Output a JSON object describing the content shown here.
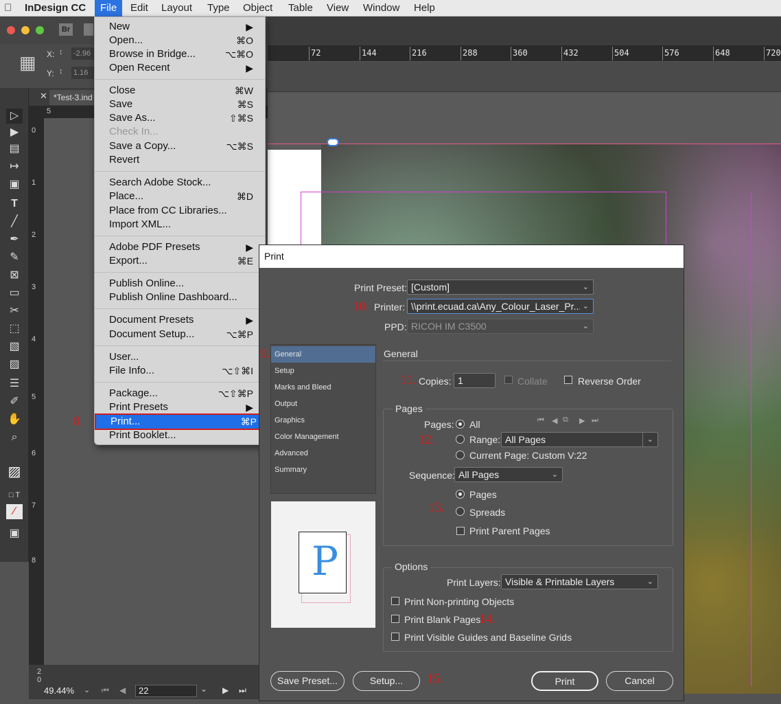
{
  "menubar": {
    "app": "InDesign CC",
    "items": [
      "File",
      "Edit",
      "Layout",
      "Type",
      "Object",
      "Table",
      "View",
      "Window",
      "Help"
    ]
  },
  "control": {
    "x_label": "X:",
    "y_label": "Y:",
    "x_value": "-2.96",
    "y_value": "1.16"
  },
  "ruler": {
    "ticks": [
      "72",
      "144",
      "216",
      "288",
      "360",
      "432",
      "504",
      "576",
      "648",
      "720"
    ],
    "left_tick": "5",
    "vticks": [
      "0",
      "1",
      "2",
      "3",
      "4",
      "5",
      "6",
      "7",
      "8"
    ]
  },
  "doc_tab": "*Test-3.ind",
  "statusbar": {
    "zoom": "49.44%",
    "page": "22",
    "left_num": "2 0"
  },
  "file_menu": {
    "items": [
      {
        "label": "New",
        "shortcut": "▶"
      },
      {
        "label": "Open...",
        "shortcut": "⌘O"
      },
      {
        "label": "Browse in Bridge...",
        "shortcut": "⌥⌘O"
      },
      {
        "label": "Open Recent",
        "shortcut": "▶"
      },
      {
        "label": "Close",
        "shortcut": "⌘W"
      },
      {
        "label": "Save",
        "shortcut": "⌘S"
      },
      {
        "label": "Save As...",
        "shortcut": "⇧⌘S"
      },
      {
        "label": "Check In...",
        "shortcut": ""
      },
      {
        "label": "Save a Copy...",
        "shortcut": "⌥⌘S"
      },
      {
        "label": "Revert",
        "shortcut": ""
      },
      {
        "label": "Search Adobe Stock...",
        "shortcut": ""
      },
      {
        "label": "Place...",
        "shortcut": "⌘D"
      },
      {
        "label": "Place from CC Libraries...",
        "shortcut": ""
      },
      {
        "label": "Import XML...",
        "shortcut": ""
      },
      {
        "label": "Adobe PDF Presets",
        "shortcut": "▶"
      },
      {
        "label": "Export...",
        "shortcut": "⌘E"
      },
      {
        "label": "Publish Online...",
        "shortcut": ""
      },
      {
        "label": "Publish Online Dashboard...",
        "shortcut": ""
      },
      {
        "label": "Document Presets",
        "shortcut": "▶"
      },
      {
        "label": "Document Setup...",
        "shortcut": "⌥⌘P"
      },
      {
        "label": "User...",
        "shortcut": ""
      },
      {
        "label": "File Info...",
        "shortcut": "⌥⇧⌘I"
      },
      {
        "label": "Package...",
        "shortcut": "⌥⇧⌘P"
      },
      {
        "label": "Print Presets",
        "shortcut": "▶"
      },
      {
        "label": "Print...",
        "shortcut": "⌘P"
      },
      {
        "label": "Print Booklet...",
        "shortcut": ""
      }
    ]
  },
  "steps": {
    "s8": "8.",
    "s9": "9.",
    "s10": "10.",
    "s11": "11.",
    "s12": "12.",
    "s13": "13.",
    "s14": "14.",
    "s15": "15."
  },
  "dialog": {
    "title": "Print",
    "preset_label": "Print Preset:",
    "preset_value": "[Custom]",
    "printer_label": "Printer:",
    "printer_value": "\\\\print.ecuad.ca\\Any_Colour_Laser_Pr...",
    "ppd_label": "PPD:",
    "ppd_value": "RICOH IM C3500",
    "nav": [
      "General",
      "Setup",
      "Marks and Bleed",
      "Output",
      "Graphics",
      "Color Management",
      "Advanced",
      "Summary"
    ],
    "section_title": "General",
    "copies_label": "Copies:",
    "copies_value": "1",
    "collate": "Collate",
    "reverse": "Reverse Order",
    "pages_group": "Pages",
    "pages_label": "Pages:",
    "all": "All",
    "range_label": "Range:",
    "range_value": "All Pages",
    "current_page": "Current Page: Custom V:22",
    "sequence_label": "Sequence:",
    "sequence_value": "All Pages",
    "opt_pages": "Pages",
    "opt_spreads": "Spreads",
    "print_parent": "Print Parent Pages",
    "options_group": "Options",
    "layers_label": "Print Layers:",
    "layers_value": "Visible & Printable Layers",
    "nonprinting": "Print Non-printing Objects",
    "blank": "Print Blank Pages",
    "guides": "Print Visible Guides and Baseline Grids",
    "preview_letter": "P",
    "save_preset": "Save Preset...",
    "setup": "Setup...",
    "print": "Print",
    "cancel": "Cancel"
  }
}
